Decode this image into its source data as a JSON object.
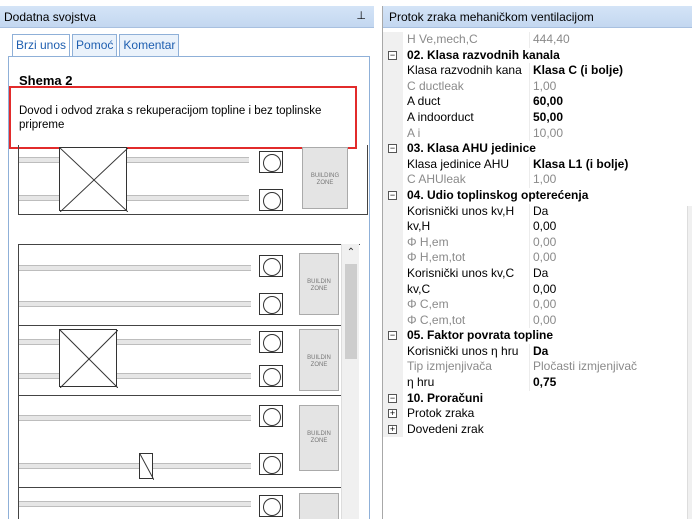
{
  "left_panel": {
    "title": "Dodatna svojstva",
    "pin": "ၠ",
    "tabs": [
      "Brzi unos",
      "Pomoć",
      "Komentar"
    ],
    "schema_title": "Shema 2",
    "description": "Dovod i odvod zraka s rekuperacijom topline i bez toplinske pripreme",
    "zone_label": "BUILDING ZONE",
    "zone_label_short": "BUILDIN ZONE"
  },
  "right_panel": {
    "title": "Protok zraka mehaničkom ventilacijom",
    "rows": [
      {
        "type": "prop",
        "name": "H Ve,mech,C",
        "value": "444,40",
        "dim": true
      },
      {
        "type": "sec",
        "toggle": "−",
        "name": "02. Klasa razvodnih kanala"
      },
      {
        "type": "prop",
        "name": "Klasa razvodnih kana",
        "value": "Klasa C (i bolje)",
        "bold": true
      },
      {
        "type": "prop",
        "name": "C ductleak",
        "value": "1,00",
        "dim": true
      },
      {
        "type": "prop",
        "name": "A duct",
        "value": "60,00",
        "bold": true
      },
      {
        "type": "prop",
        "name": "A indoorduct",
        "value": "50,00",
        "bold": true
      },
      {
        "type": "prop",
        "name": "A i",
        "value": "10,00",
        "dim": true
      },
      {
        "type": "sec",
        "toggle": "−",
        "name": "03. Klasa AHU jedinice"
      },
      {
        "type": "prop",
        "name": "Klasa jedinice AHU",
        "value": "Klasa L1 (i bolje)",
        "bold": true
      },
      {
        "type": "prop",
        "name": "C AHUleak",
        "value": "1,00",
        "dim": true
      },
      {
        "type": "sec",
        "toggle": "−",
        "name": "04. Udio toplinskog opterećenja"
      },
      {
        "type": "prop",
        "name": "Korisnički unos kv,H",
        "value": "Da"
      },
      {
        "type": "prop",
        "name": "kv,H",
        "value": "0,00"
      },
      {
        "type": "prop",
        "name": "Φ H,em",
        "value": "0,00",
        "dim": true
      },
      {
        "type": "prop",
        "name": "Φ H,em,tot",
        "value": "0,00",
        "dim": true
      },
      {
        "type": "prop",
        "name": "Korisnički unos kv,C",
        "value": "Da"
      },
      {
        "type": "prop",
        "name": "kv,C",
        "value": "0,00"
      },
      {
        "type": "prop",
        "name": "Φ C,em",
        "value": "0,00",
        "dim": true
      },
      {
        "type": "prop",
        "name": "Φ C,em,tot",
        "value": "0,00",
        "dim": true
      },
      {
        "type": "sec",
        "toggle": "−",
        "name": "05. Faktor povrata topline"
      },
      {
        "type": "prop",
        "name": "Korisnički unos η hru",
        "value": "Da",
        "bold": true
      },
      {
        "type": "prop",
        "name": "Tip izmjenjivača",
        "value": "Pločasti izmjenjivač",
        "dim": true
      },
      {
        "type": "prop",
        "name": "η hru",
        "value": "0,75",
        "bold": true
      },
      {
        "type": "sec",
        "toggle": "−",
        "name": "10. Proračuni"
      },
      {
        "type": "sub",
        "toggle": "+",
        "name": "Protok zraka"
      },
      {
        "type": "sub",
        "toggle": "+",
        "name": "Dovedeni zrak"
      }
    ]
  }
}
